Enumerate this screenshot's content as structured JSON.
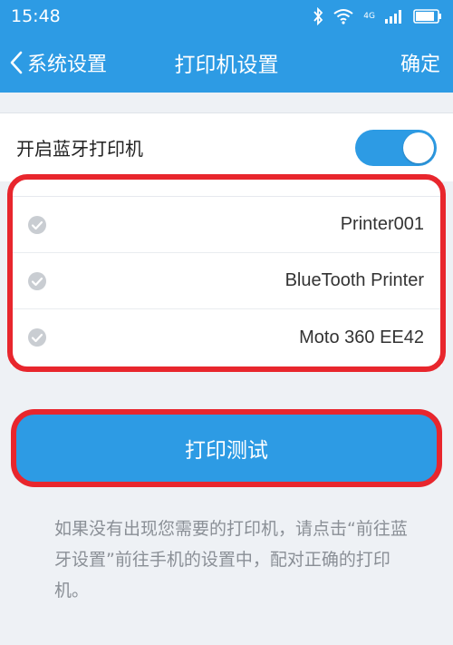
{
  "status_bar": {
    "time": "15:48",
    "network_label": "4G"
  },
  "nav": {
    "back_label": "系统设置",
    "title": "打印机设置",
    "confirm_label": "确定"
  },
  "bluetooth_toggle": {
    "label": "开启蓝牙打印机",
    "on": true
  },
  "printers": [
    {
      "name": "Printer001"
    },
    {
      "name": "BlueTooth Printer"
    },
    {
      "name": "Moto 360 EE42"
    }
  ],
  "print_test_button": {
    "label": "打印测试"
  },
  "hint": {
    "text": "如果没有出现您需要的打印机，请点击“前往蓝牙设置”前往手机的设置中，配对正确的打印机。"
  },
  "colors": {
    "accent": "#2d9be4",
    "highlight": "#e8262d"
  }
}
